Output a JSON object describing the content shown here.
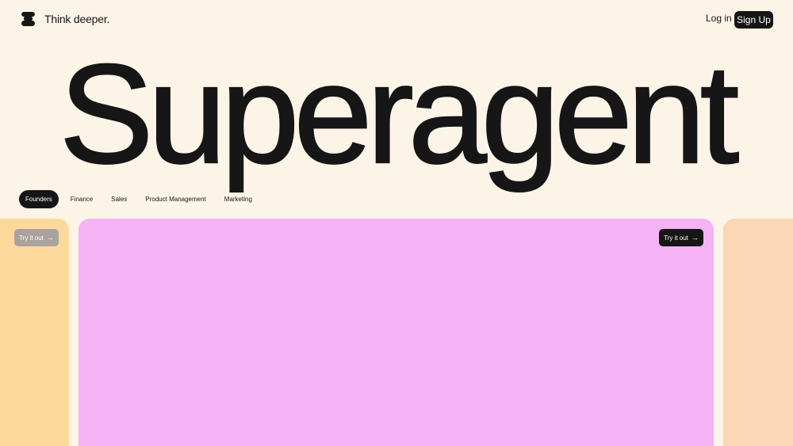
{
  "header": {
    "brand": "Think deeper.",
    "login_label": "Log in",
    "signup_label": "Sign Up"
  },
  "hero": {
    "title": "Superagent"
  },
  "tabs": [
    {
      "label": "Founders",
      "active": true
    },
    {
      "label": "Finance",
      "active": false
    },
    {
      "label": "Sales",
      "active": false
    },
    {
      "label": "Product Management",
      "active": false
    },
    {
      "label": "Marketing",
      "active": false
    }
  ],
  "cards": {
    "left": {
      "button_label": "Try it out",
      "color": "#FCD99A"
    },
    "main": {
      "button_label": "Try it out",
      "color": "#F5B2F4"
    },
    "right": {
      "color": "#FBD7B5"
    }
  },
  "icons": {
    "logo": "stacked-logo-icon",
    "arrow": "arrow-right-icon"
  },
  "colors": {
    "background": "#FDF4E8",
    "text": "#161616",
    "accent": "#161616"
  }
}
